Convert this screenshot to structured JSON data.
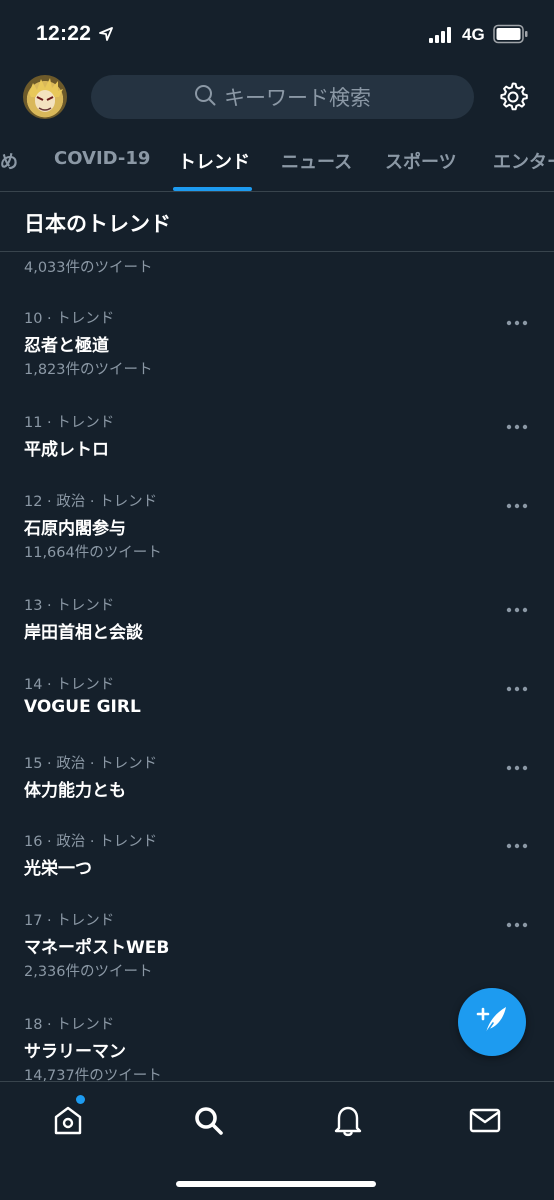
{
  "status_bar": {
    "time": "12:22",
    "network": "4G"
  },
  "search": {
    "placeholder": "キーワード検索"
  },
  "tabs": [
    {
      "label": "め"
    },
    {
      "label": "COVID-19"
    },
    {
      "label": "トレンド",
      "active": true
    },
    {
      "label": "ニュース"
    },
    {
      "label": "スポーツ"
    },
    {
      "label": "エンター"
    }
  ],
  "section": {
    "title": "日本のトレンド",
    "partial_count": "4,033件のツイート"
  },
  "trends": [
    {
      "meta": "10 · トレンド",
      "name": "忍者と極道",
      "count": "1,823件のツイート"
    },
    {
      "meta": "11 · トレンド",
      "name": "平成レトロ",
      "count": ""
    },
    {
      "meta": "12 · 政治 · トレンド",
      "name": "石原内閣参与",
      "count": "11,664件のツイート"
    },
    {
      "meta": "13 · トレンド",
      "name": "岸田首相と会談",
      "count": ""
    },
    {
      "meta": "14 · トレンド",
      "name": "VOGUE GIRL",
      "count": ""
    },
    {
      "meta": "15 · 政治 · トレンド",
      "name": "体力能力とも",
      "count": ""
    },
    {
      "meta": "16 · 政治 · トレンド",
      "name": "光栄一つ",
      "count": ""
    },
    {
      "meta": "17 · トレンド",
      "name": "マネーポストWEB",
      "count": "2,336件のツイート"
    },
    {
      "meta": "18 · トレンド",
      "name": "サラリーマン",
      "count": "14,737件のツイート"
    }
  ],
  "icons": {
    "nav": [
      "home-icon",
      "search-icon",
      "bell-icon",
      "mail-icon"
    ],
    "fab": "compose-tweet-icon"
  },
  "colors": {
    "accent": "#1d9bf0",
    "background": "#15202b",
    "secondary_text": "#8b98a5"
  }
}
